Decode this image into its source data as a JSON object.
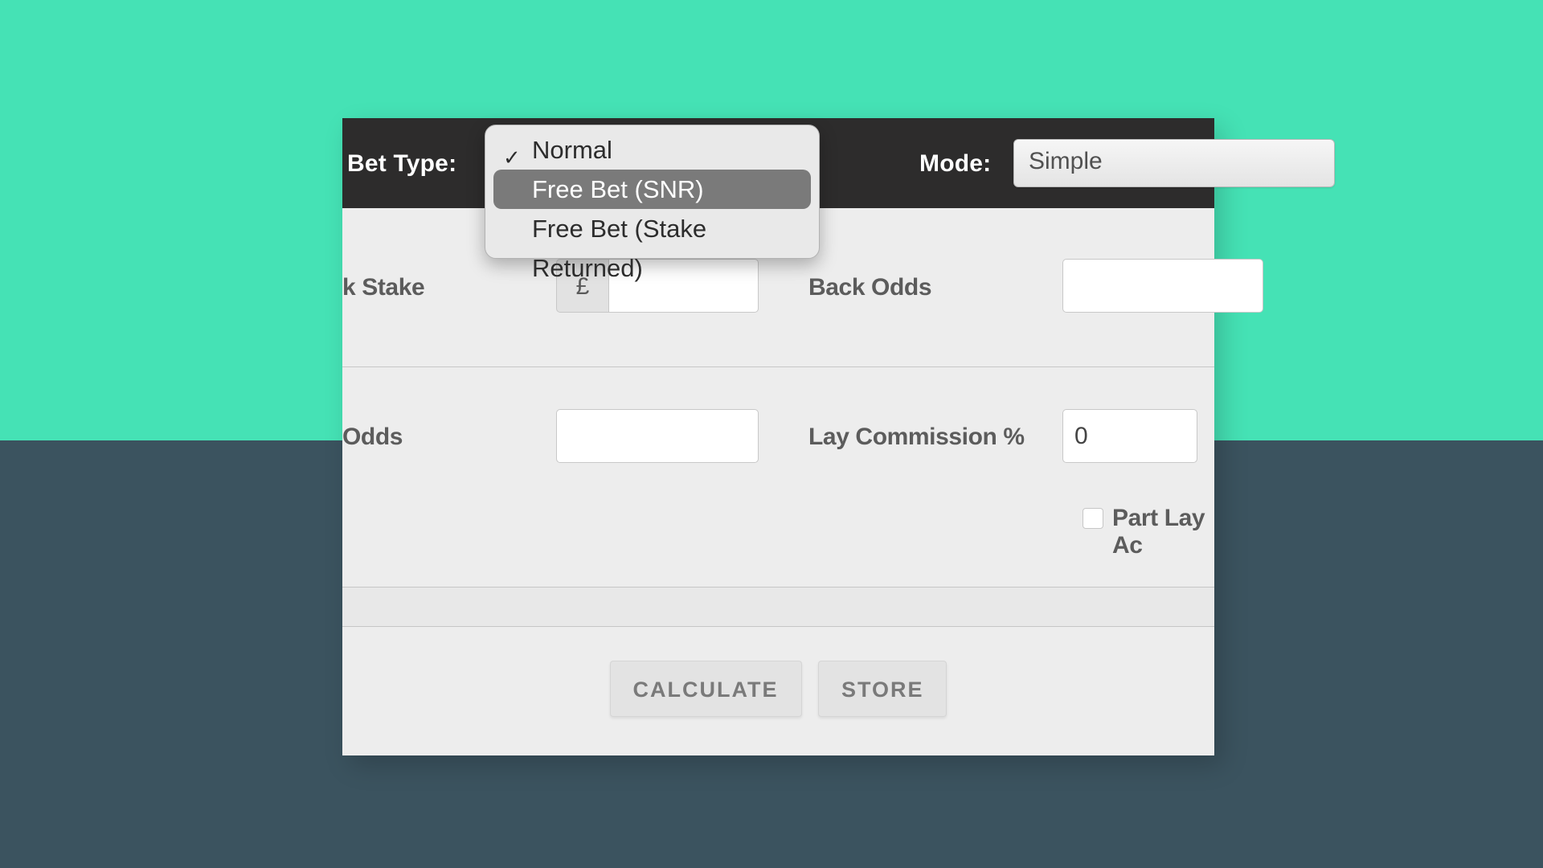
{
  "topbar": {
    "bet_type_label": "Bet Type:",
    "mode_label": "Mode:",
    "mode_value": "Simple"
  },
  "bet_type_dropdown": {
    "options": [
      {
        "label": "Normal",
        "checked": true,
        "selected": false
      },
      {
        "label": "Free Bet (SNR)",
        "checked": false,
        "selected": true
      },
      {
        "label": "Free Bet (Stake Returned)",
        "checked": false,
        "selected": false
      }
    ]
  },
  "fields": {
    "back_stake_label": "k Stake",
    "back_stake_currency": "£",
    "back_stake_value": "",
    "back_odds_label": "Back Odds",
    "back_odds_value": "",
    "lay_odds_label": "Odds",
    "lay_odds_value": "",
    "lay_commission_label": "Lay Commission %",
    "lay_commission_value": "0",
    "part_lay_label": "Part Lay Ac",
    "part_lay_checked": false
  },
  "buttons": {
    "calculate": "CALCULATE",
    "store": "STORE"
  }
}
